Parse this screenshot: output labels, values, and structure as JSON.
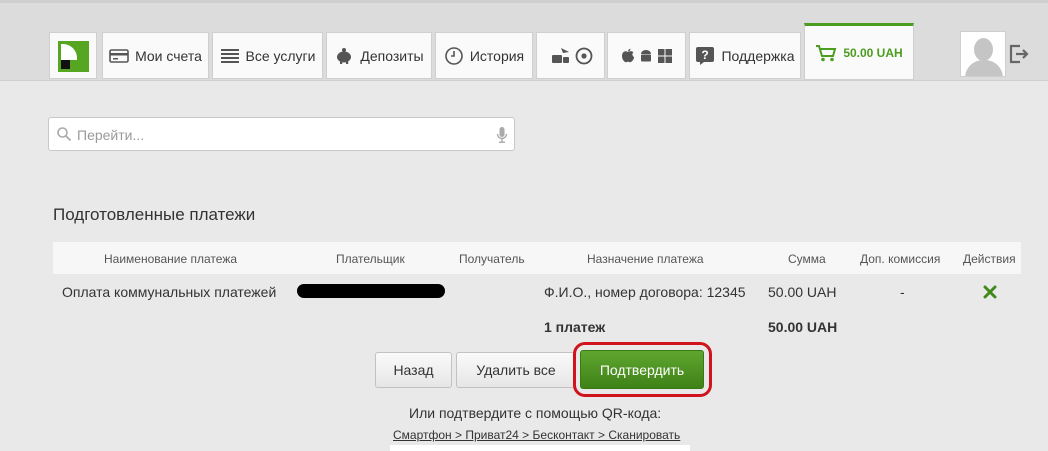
{
  "nav": {
    "tabs": [
      {
        "label": "Мои счета",
        "icon": "credit-card-icon"
      },
      {
        "label": "Все услуги",
        "icon": "list-icon"
      },
      {
        "label": "Депозиты",
        "icon": "piggy-bank-icon"
      },
      {
        "label": "История",
        "icon": "history-icon"
      }
    ],
    "travel_icons": [
      "train-icon",
      "plane-icon",
      "bus-icon",
      "football-icon"
    ],
    "platform_icons": [
      "apple-icon",
      "android-icon",
      "windows-icon"
    ],
    "support_label": "Поддержка",
    "cart_amount": "50.00 UAH",
    "accent_color": "#4b9c1f"
  },
  "search": {
    "placeholder": "Перейти..."
  },
  "page": {
    "title": "Подготовленные платежи"
  },
  "table": {
    "headers": [
      "Наименование платежа",
      "Плательщик",
      "Получатель",
      "Назначение платежа",
      "Сумма",
      "Доп. комиссия",
      "Действия"
    ],
    "rows": [
      {
        "name": "Оплата коммунальных платежей",
        "payer": "",
        "recipient": "",
        "purpose": "Ф.И.О., номер договора: 12345",
        "amount": "50.00 UAH",
        "commission": "-",
        "action_icon": "delete-x-icon"
      }
    ],
    "total": {
      "count": "1  платеж",
      "amount": "50.00 UAH"
    }
  },
  "actions": {
    "back": "Назад",
    "delete_all": "Удалить все",
    "confirm": "Подтвердить"
  },
  "qr": {
    "text": "Или подтвердите с помощью QR-кода:",
    "link": "Смартфон > Приват24 > Бесконтакт > Сканировать"
  }
}
